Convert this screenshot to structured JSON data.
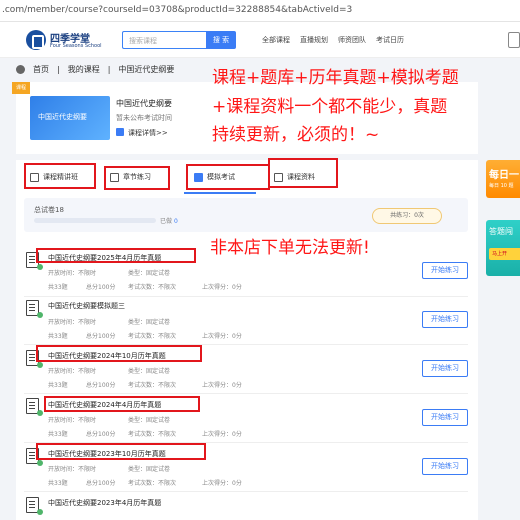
{
  "browser": {
    "url": ".com/member/course?courseId=03708&productId=32288854&tabActiveId=3"
  },
  "header": {
    "logo_text": "四季学堂",
    "logo_sub": "Four Seasons School",
    "search_placeholder": "搜索课程",
    "search_button": "搜 索",
    "nav": [
      "全部课程",
      "直播规划",
      "师资团队",
      "考试日历"
    ]
  },
  "breadcrumb": [
    "首页",
    "我的课程",
    "中国近代史纲要"
  ],
  "course": {
    "ribbon": "课程",
    "cover_title": "中国近代史纲要",
    "title": "中国近代史纲要",
    "exam_time": "暂未公布考试时间",
    "details_link": "课程详情>>"
  },
  "promo": {
    "line1": "课程+题库+历年真题+模拟考题",
    "line2": "+课程资料一个都不能少，真题",
    "line3": "持续更新，必须的！~",
    "line4": "非本店下单无法更新!"
  },
  "tabs": [
    {
      "label": "课程精讲班",
      "active": false
    },
    {
      "label": "章节练习",
      "active": false
    },
    {
      "label": "模拟考试",
      "active": true
    },
    {
      "label": "课程资料",
      "active": false
    }
  ],
  "summary": {
    "total": "总试卷18",
    "progress_fraction": 0,
    "done_label": "已做",
    "done_count": "0",
    "practiced": "共练习：0次"
  },
  "papers": [
    {
      "title": "中国近代史纲要2025年4月历年真题",
      "open_time": "开放时间：",
      "open_val": "不限时",
      "type_lbl": "类型：",
      "type_val": "固定试卷",
      "count": "共33题",
      "score": "总分100分",
      "exam_count": "考试次数：",
      "exam_val": "不限次",
      "last": "上次得分：0分",
      "button": "开始练习",
      "highlighted": true
    },
    {
      "title": "中国近代史纲要模拟题三",
      "open_time": "开放时间：",
      "open_val": "不限时",
      "type_lbl": "类型：",
      "type_val": "固定试卷",
      "count": "共33题",
      "score": "总分100分",
      "exam_count": "考试次数：",
      "exam_val": "不限次",
      "last": "上次得分：0分",
      "button": "开始练习",
      "highlighted": false
    },
    {
      "title": "中国近代史纲要2024年10月历年真题",
      "open_time": "开放时间：",
      "open_val": "不限时",
      "type_lbl": "类型：",
      "type_val": "固定试卷",
      "count": "共33题",
      "score": "总分100分",
      "exam_count": "考试次数：",
      "exam_val": "不限次",
      "last": "上次得分：0分",
      "button": "开始练习",
      "highlighted": true
    },
    {
      "title": "中国近代史纲要2024年4月历年真题",
      "open_time": "开放时间：",
      "open_val": "不限时",
      "type_lbl": "类型：",
      "type_val": "固定试卷",
      "count": "共33题",
      "score": "总分100分",
      "exam_count": "考试次数：",
      "exam_val": "不限次",
      "last": "上次得分：0分",
      "button": "开始练习",
      "highlighted": true
    },
    {
      "title": "中国近代史纲要2023年10月历年真题",
      "open_time": "开放时间：",
      "open_val": "不限时",
      "type_lbl": "类型：",
      "type_val": "固定试卷",
      "count": "共33题",
      "score": "总分100分",
      "exam_count": "考试次数：",
      "exam_val": "不限次",
      "last": "上次得分：0分",
      "button": "开始练习",
      "highlighted": true
    },
    {
      "title": "中国近代史纲要2023年4月历年真题",
      "highlighted": false
    }
  ],
  "side": {
    "banner1_title": "每日一",
    "banner1_sub": "每日 10 题",
    "banner2_title": "答题闯",
    "banner2_btn": "马上开"
  },
  "colors": {
    "accent": "#3b7cf5",
    "annotation": "#e2161c",
    "promo": "#ff1616"
  }
}
